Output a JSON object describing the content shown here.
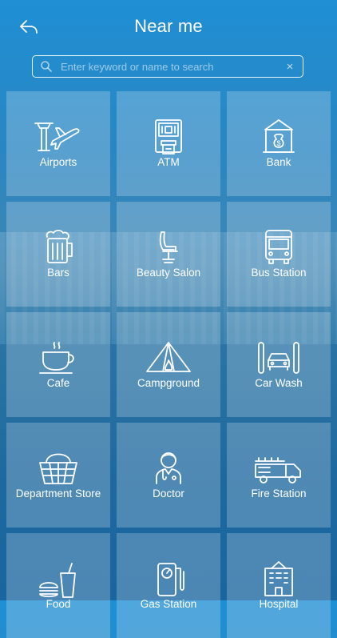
{
  "header": {
    "title": "Near me",
    "back_icon": "back-arrow-icon"
  },
  "search": {
    "placeholder": "Enter keyword or name to search",
    "value": "",
    "clear_label": "×"
  },
  "categories": [
    {
      "label": "Airports",
      "icon": "airport-icon"
    },
    {
      "label": "ATM",
      "icon": "atm-icon"
    },
    {
      "label": "Bank",
      "icon": "bank-icon"
    },
    {
      "label": "Bars",
      "icon": "beer-mug-icon"
    },
    {
      "label": "Beauty Salon",
      "icon": "salon-chair-icon"
    },
    {
      "label": "Bus Station",
      "icon": "bus-icon"
    },
    {
      "label": "Cafe",
      "icon": "coffee-cup-icon"
    },
    {
      "label": "Campground",
      "icon": "tent-icon"
    },
    {
      "label": "Car Wash",
      "icon": "car-wash-icon"
    },
    {
      "label": "Department Store",
      "icon": "basket-icon"
    },
    {
      "label": "Doctor",
      "icon": "doctor-icon"
    },
    {
      "label": "Fire Station",
      "icon": "fire-truck-icon"
    },
    {
      "label": "Food",
      "icon": "food-icon"
    },
    {
      "label": "Gas Station",
      "icon": "gas-pump-icon"
    },
    {
      "label": "Hospital",
      "icon": "hospital-icon"
    }
  ]
}
